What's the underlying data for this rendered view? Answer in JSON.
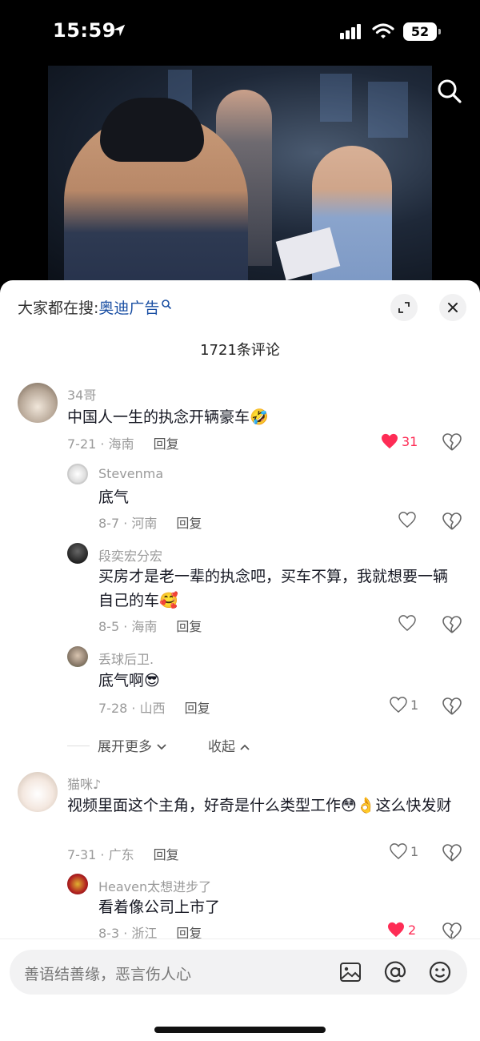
{
  "status": {
    "time": "15:59",
    "battery": "52"
  },
  "sheet": {
    "search_prefix": "大家都在搜:",
    "search_keyword": "奥迪广告",
    "comment_count": "1721条评论"
  },
  "comments": [
    {
      "user": "34哥",
      "text": "中国人一生的执念开辆豪车🤣",
      "meta": "7-21 · 海南",
      "reply": "回复",
      "likes": "31",
      "liked": true
    },
    {
      "user": "Stevenma",
      "text": "底气",
      "meta": "8-7 · 河南",
      "reply": "回复",
      "likes": "",
      "liked": false
    },
    {
      "user": "段奕宏分宏",
      "text": "买房才是老一辈的执念吧，买车不算，我就想要一辆自己的车🥰",
      "meta": "8-5 · 海南",
      "reply": "回复",
      "likes": "",
      "liked": false
    },
    {
      "user": "丢球后卫.",
      "text": "底气啊😎",
      "meta": "7-28 · 山西",
      "reply": "回复",
      "likes": "1",
      "liked": false
    },
    {
      "user": "猫咪♪",
      "text": "视频里面这个主角，好奇是什么类型工作😳👌这么快发财",
      "meta": "7-31 · 广东",
      "reply": "回复",
      "likes": "1",
      "liked": false
    },
    {
      "user": "Heaven太想进步了",
      "text": "看着像公司上市了",
      "meta": "8-3 · 浙江",
      "reply": "回复",
      "likes": "2",
      "liked": true
    }
  ],
  "expand": {
    "more": "展开更多",
    "collapse": "收起"
  },
  "input": {
    "placeholder": "善语结善缘，恶言伤人心"
  },
  "colors": {
    "accent": "#fe2c55",
    "keyword": "#1a4fa3"
  },
  "icons": [
    "search-icon",
    "expand-icon",
    "close-icon",
    "heart-icon",
    "broken-heart-icon",
    "image-icon",
    "at-icon",
    "emoji-icon"
  ]
}
